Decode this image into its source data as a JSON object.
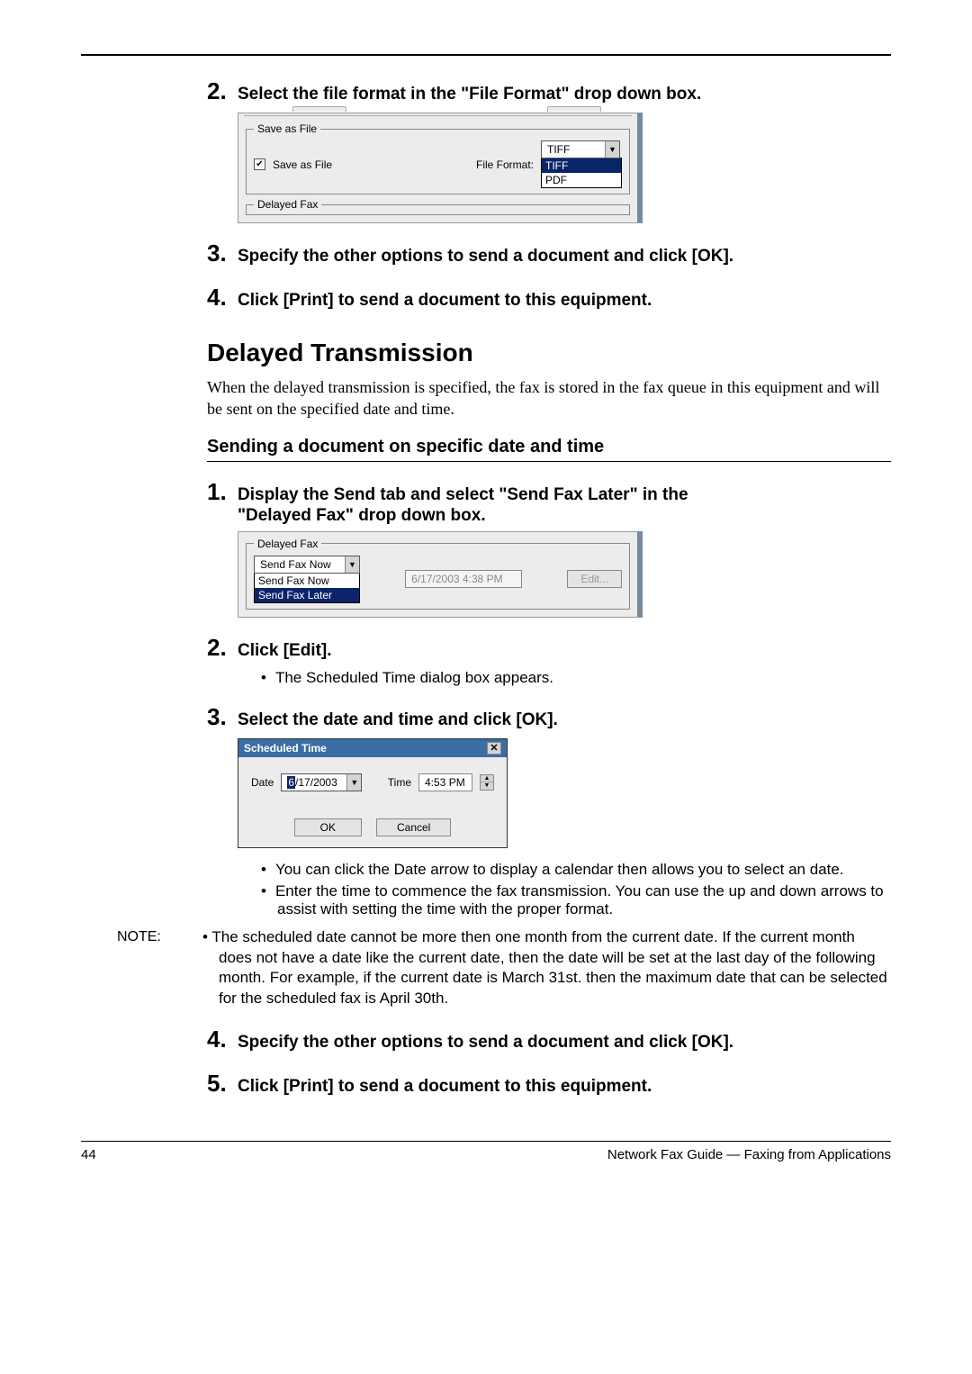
{
  "steps_top": {
    "s2": {
      "num": "2.",
      "text": "Select the file format in the \"File Format\" drop down box."
    },
    "s3": {
      "num": "3.",
      "text": "Specify the other options to send a document and click [OK]."
    },
    "s4": {
      "num": "4.",
      "text": "Click [Print] to send a document to this equipment."
    }
  },
  "fig1": {
    "group1_title": "Save as File",
    "checkbox_label": "Save as File",
    "checkbox_mark": "✔",
    "format_label": "File Format:",
    "dd_value": "TIFF",
    "dd_opt1": "TIFF",
    "dd_opt2": "PDF",
    "group2_title": "Delayed Fax"
  },
  "section": {
    "h2": "Delayed Transmission",
    "para": "When the delayed transmission is specified, the fax is stored in the fax queue in this equipment and will be sent on the specified date and time.",
    "h3": "Sending a document on specific date and time"
  },
  "steps_mid": {
    "s1": {
      "num": "1.",
      "line1": "Display the Send tab and select \"Send Fax Later\" in the",
      "line2": "\"Delayed Fax\" drop down box."
    },
    "s2": {
      "num": "2.",
      "text": "Click [Edit].",
      "bullet": "The Scheduled Time dialog box appears."
    },
    "s3": {
      "num": "3.",
      "text": "Select the date and time and click [OK]."
    }
  },
  "fig2": {
    "group_title": "Delayed Fax",
    "dd_value": "Send Fax Now",
    "dd_opt1": "Send Fax Now",
    "dd_opt2": "Send Fax Later",
    "datetime": "6/17/2003 4:38 PM",
    "edit_btn": "Edit..."
  },
  "dlg": {
    "title": "Scheduled Time",
    "date_label": "Date",
    "date_value": "6/17/2003",
    "time_label": "Time",
    "time_value": "4:53 PM",
    "ok": "OK",
    "cancel": "Cancel"
  },
  "bullets_after_dlg": {
    "b1": "You can click the Date arrow to display a calendar then allows you to select an date.",
    "b2": "Enter the time to commence the fax transmission. You can use the up and down arrows to assist with setting the time with the proper format."
  },
  "note": {
    "label": "NOTE:",
    "text": "The scheduled date cannot be more then one month from the current date.  If the current month does not have a date like the current date, then the date will be set at the last day of the following month. For example, if the current date is March 31st. then the maximum date that can be selected for the scheduled fax is April 30th."
  },
  "steps_bottom": {
    "s4": {
      "num": "4.",
      "text": "Specify the other options to send a document and click [OK]."
    },
    "s5": {
      "num": "5.",
      "text": "Click [Print] to send a document to this equipment."
    }
  },
  "footer": {
    "page": "44",
    "right": "Network Fax Guide — Faxing from Applications"
  }
}
